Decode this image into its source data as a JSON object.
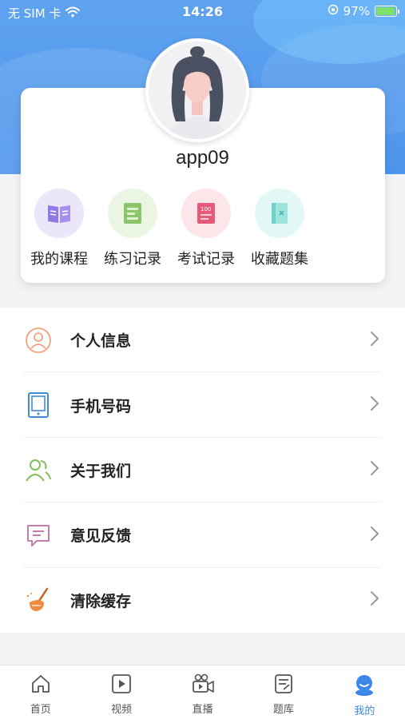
{
  "status_bar": {
    "carrier": "无 SIM 卡",
    "time": "14:26",
    "battery": "97%"
  },
  "profile": {
    "username": "app09"
  },
  "shortcuts": [
    {
      "label": "我的课程",
      "icon": "book-icon",
      "bg": "#ece6fb",
      "color": "#8f7ae6"
    },
    {
      "label": "练习记录",
      "icon": "notebook-icon",
      "bg": "#eaf6e3",
      "color": "#8bc56a"
    },
    {
      "label": "考试记录",
      "icon": "exam-paper-icon",
      "bg": "#fde6ea",
      "color": "#e65a7a"
    },
    {
      "label": "收藏题集",
      "icon": "bookmark-book-icon",
      "bg": "#e1f8f6",
      "color": "#6fd3cc"
    }
  ],
  "menu": [
    {
      "label": "个人信息",
      "icon": "user-icon",
      "color": "#f0a07e"
    },
    {
      "label": "手机号码",
      "icon": "tablet-icon",
      "color": "#3f8bd8"
    },
    {
      "label": "关于我们",
      "icon": "users-icon",
      "color": "#7fc25a"
    },
    {
      "label": "意见反馈",
      "icon": "feedback-icon",
      "color": "#c77ab0"
    },
    {
      "label": "清除缓存",
      "icon": "broom-icon",
      "color": "#f08a3c"
    }
  ],
  "tabbar": [
    {
      "label": "首页",
      "icon": "home-icon"
    },
    {
      "label": "视频",
      "icon": "video-icon"
    },
    {
      "label": "直播",
      "icon": "live-camera-icon"
    },
    {
      "label": "题库",
      "icon": "question-bank-icon"
    },
    {
      "label": "我的",
      "icon": "profile-icon",
      "active": true
    }
  ],
  "colors": {
    "primary": "#4d95ec",
    "active_tab": "#3c88e8"
  }
}
